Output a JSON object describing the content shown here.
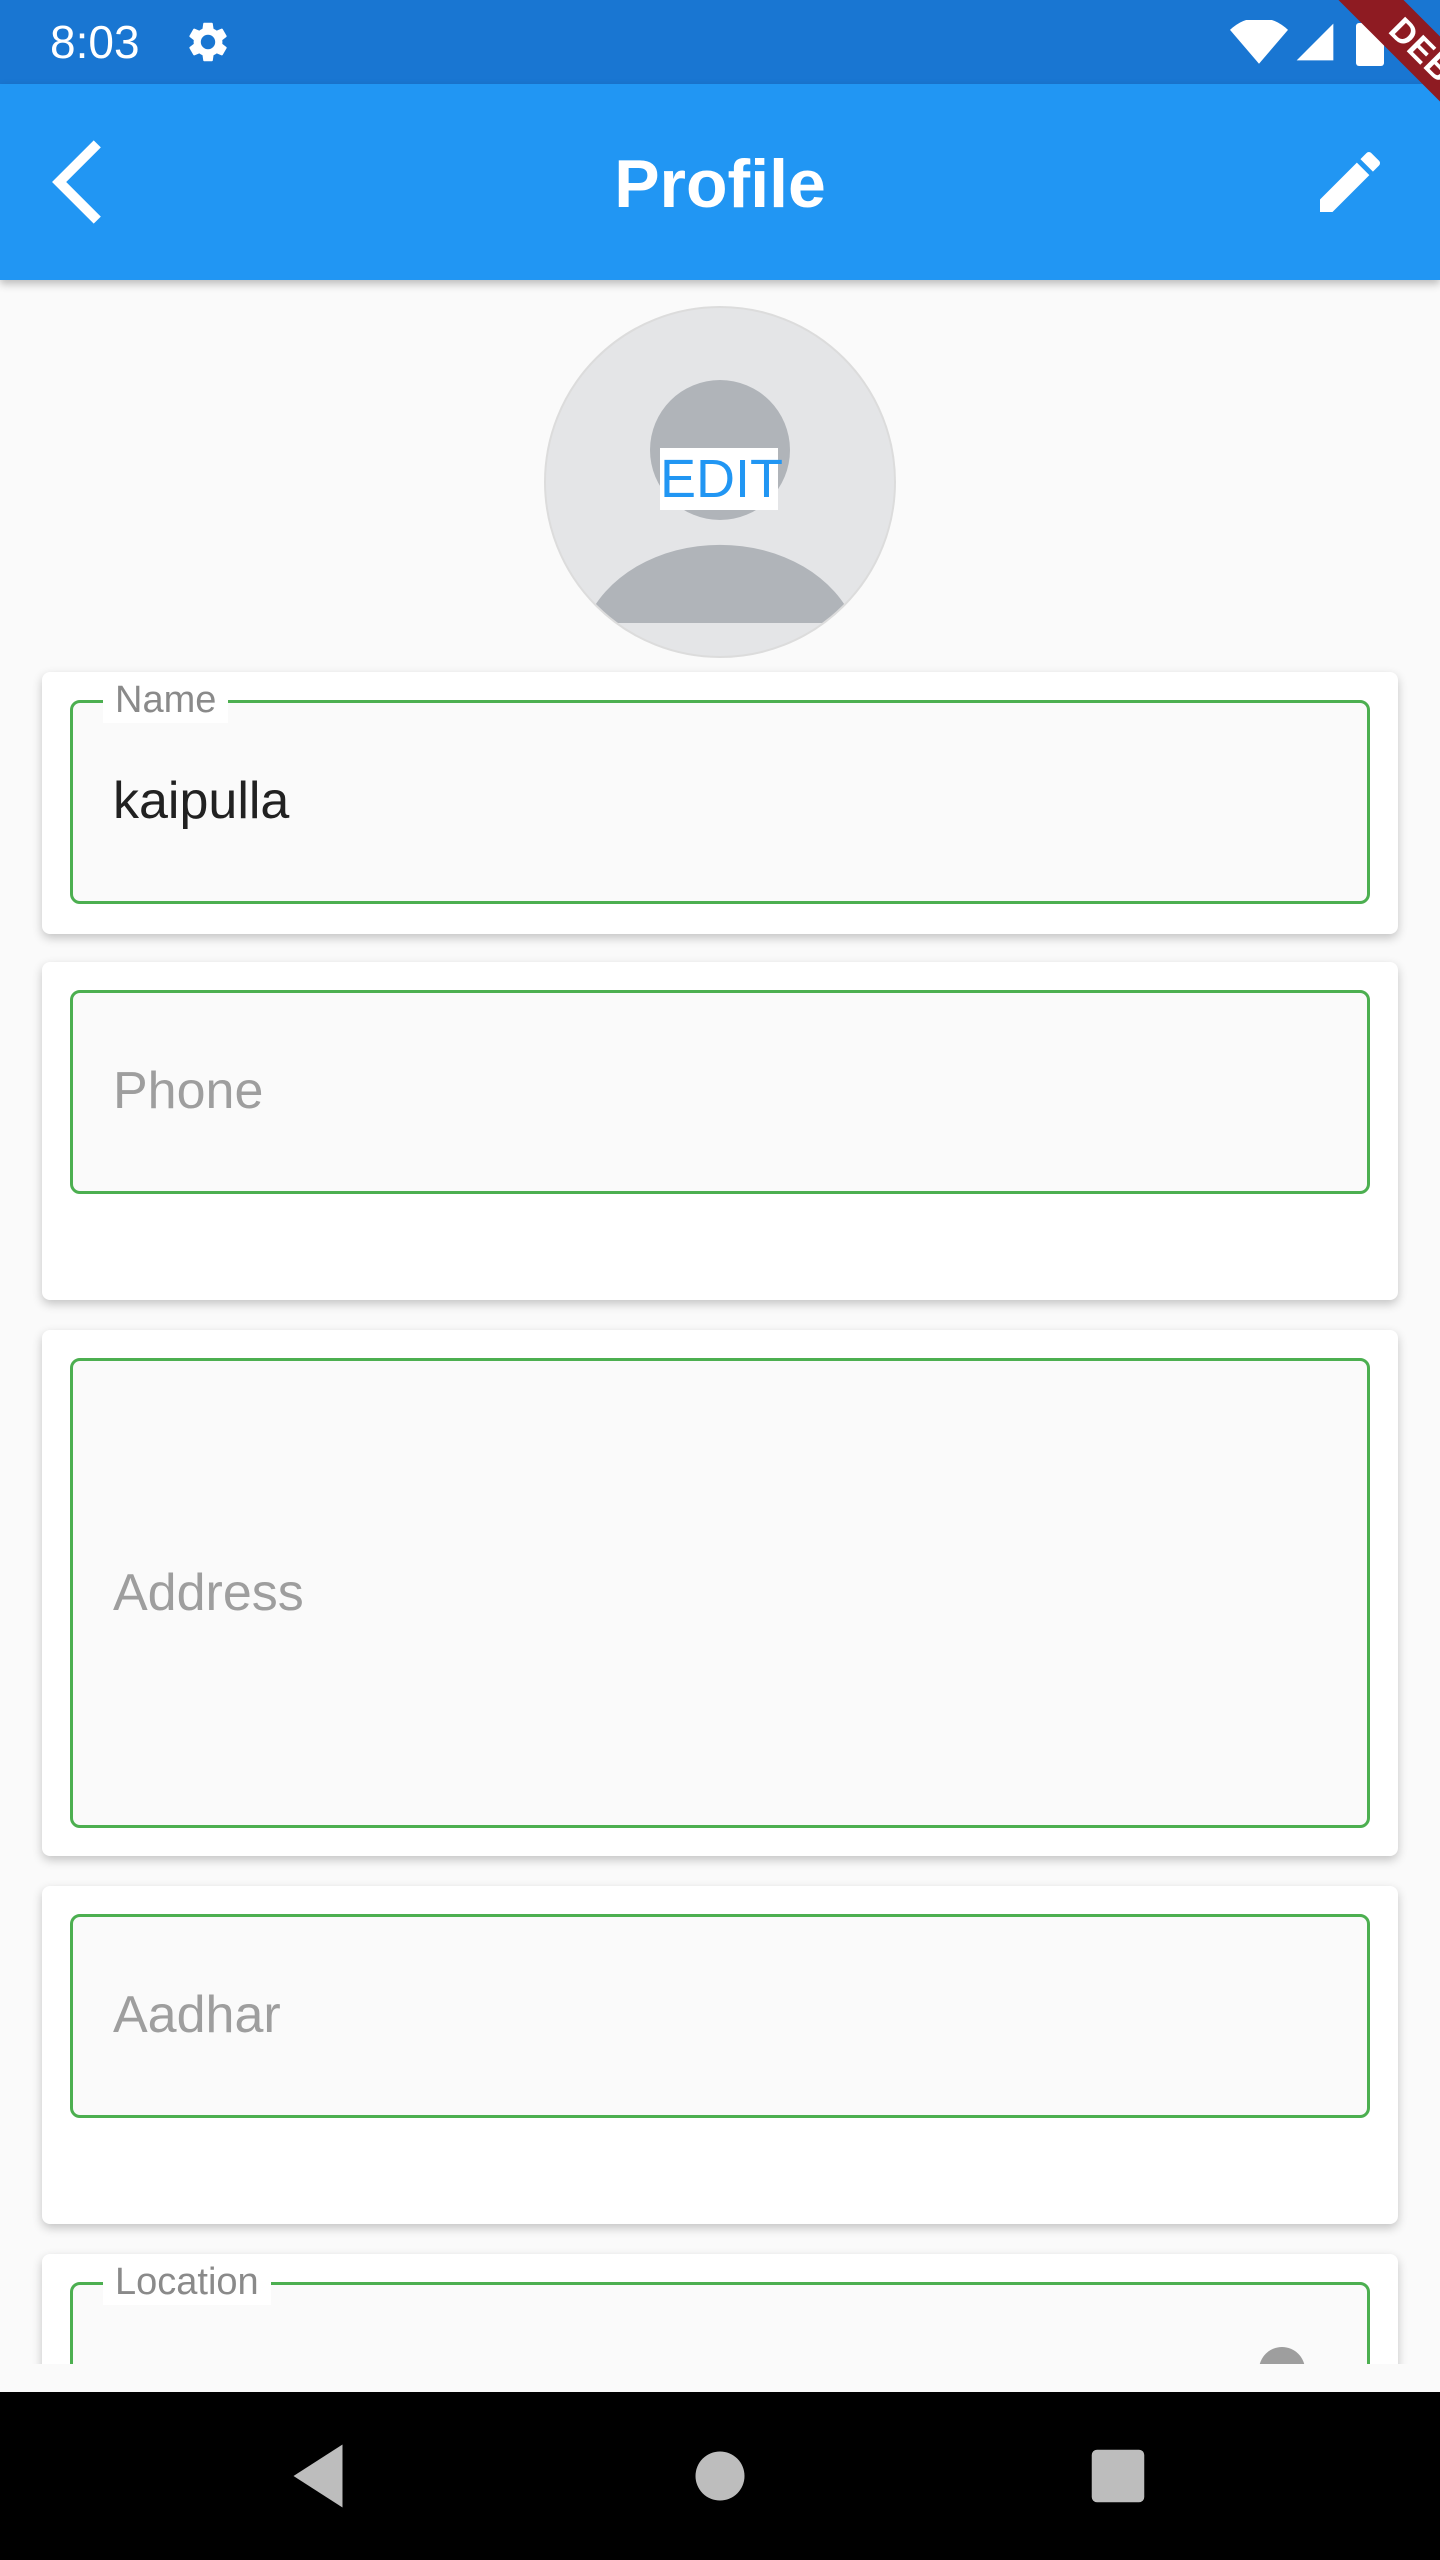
{
  "status_bar": {
    "time": "8:03",
    "background": "#1976d2",
    "icons": [
      "gear-icon",
      "wifi-icon",
      "signal-icon",
      "battery-icon"
    ]
  },
  "app_bar": {
    "title": "Profile",
    "background": "#2196f3",
    "back_icon": "back-chevron-icon",
    "action_icon": "pencil-icon"
  },
  "debug_banner": {
    "label": "DEBUG",
    "color": "#8e1b22"
  },
  "avatar": {
    "edit_label": "EDIT",
    "icon": "person-placeholder-icon"
  },
  "form": {
    "accent": "#4caf50",
    "name": {
      "label": "Name",
      "value": "kaipulla"
    },
    "phone": {
      "placeholder": "Phone"
    },
    "address": {
      "placeholder": "Address"
    },
    "aadhar": {
      "placeholder": "Aadhar"
    },
    "location": {
      "label": "Location"
    }
  },
  "nav_bar": {
    "icons": [
      "back-triangle-icon",
      "home-circle-icon",
      "recents-square-icon"
    ]
  }
}
